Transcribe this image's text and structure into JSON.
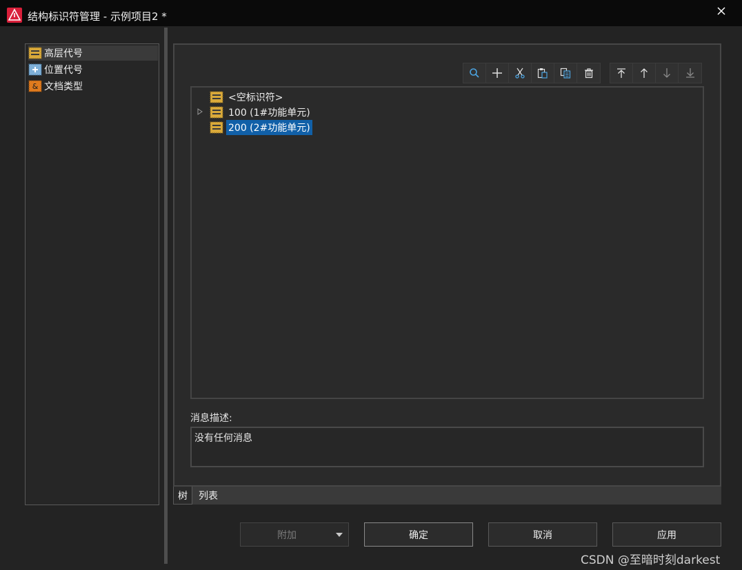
{
  "window": {
    "title": "结构标识符管理 - 示例项目2 *"
  },
  "left_list": {
    "items": [
      {
        "label": "高层代号",
        "icon": "higher-level-icon",
        "selected": true
      },
      {
        "label": "位置代号",
        "icon": "location-icon",
        "selected": false
      },
      {
        "label": "文档类型",
        "icon": "document-type-icon",
        "selected": false
      }
    ]
  },
  "toolbar": {
    "group1": [
      "search-icon",
      "add-icon",
      "cut-icon",
      "paste-icon",
      "copy-icon",
      "delete-icon"
    ],
    "group2": [
      "move-top-icon",
      "move-up-icon",
      "move-down-icon",
      "move-bottom-icon"
    ]
  },
  "tree": {
    "items": [
      {
        "label": "<空标识符>",
        "expandable": false,
        "selected": false
      },
      {
        "label": "100 (1#功能单元)",
        "expandable": true,
        "selected": false
      },
      {
        "label": "200 (2#功能单元)",
        "expandable": false,
        "selected": true
      }
    ]
  },
  "message": {
    "label": "消息描述:",
    "text": "没有任何消息"
  },
  "tabs": [
    {
      "label": "树",
      "active": true
    },
    {
      "label": "列表",
      "active": false
    }
  ],
  "buttons": {
    "attach": "附加",
    "ok": "确定",
    "cancel": "取消",
    "apply": "应用"
  },
  "watermark": "CSDN @至暗时刻darkest",
  "colors": {
    "selection": "#1160a8",
    "icon_yellow": "#d9a93a",
    "icon_blue": "#7fb0d8",
    "icon_orange": "#e07b1e",
    "logo_red": "#d91f3a"
  }
}
